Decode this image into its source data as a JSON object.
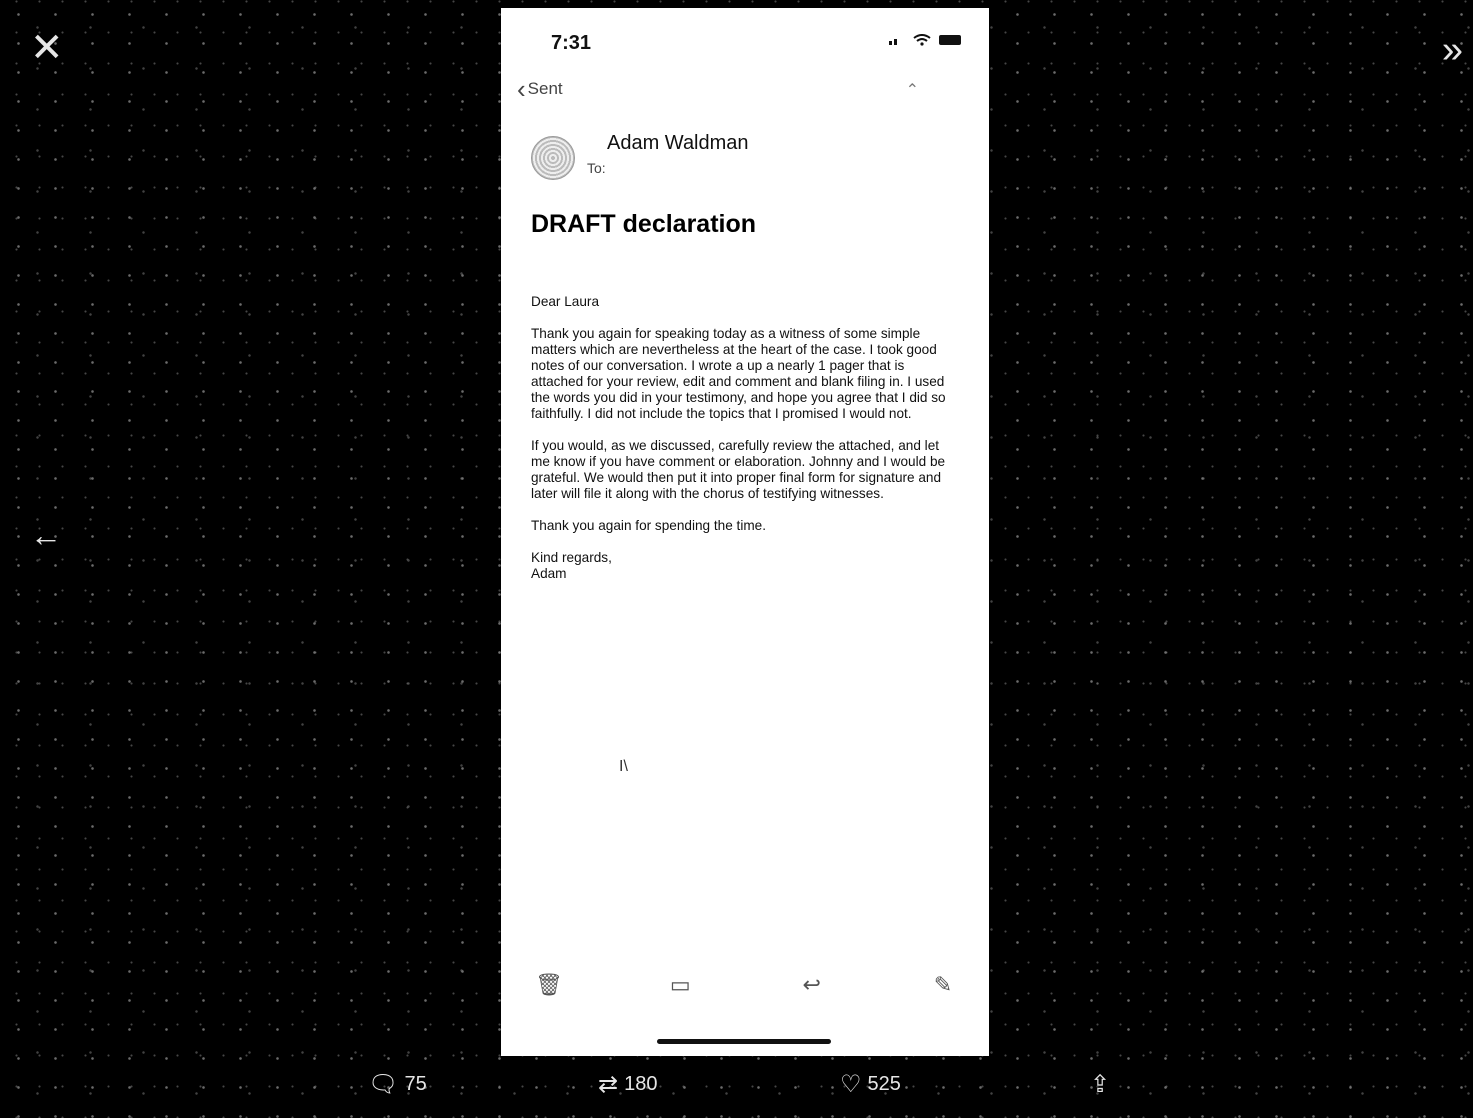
{
  "viewer": {
    "close_icon": "close-icon",
    "next_icon": "chevrons-right-icon",
    "prev_icon": "arrow-left-icon"
  },
  "phone": {
    "status": {
      "time": "7:31"
    },
    "nav": {
      "back_label": "Sent"
    },
    "sender": {
      "name": "Adam Waldman",
      "to_label": "To:"
    },
    "subject": "DRAFT declaration",
    "body": {
      "greeting": "Dear Laura",
      "p1": "Thank you again for speaking today as a witness of some simple matters which are nevertheless at the heart of the case. I took good notes of our conversation. I wrote a up a nearly 1 pager that is attached for your review, edit and comment and blank filing in. I used the words you did in your testimony, and hope you agree that I did so faithfully. I did not include the topics that I promised I would not.",
      "p2": "If you would, as we discussed, carefully review the attached, and let me know if you have comment or elaboration. Johnny and I would be grateful. We would then put it into proper final form for signature and later will file it along with the chorus of testifying witnesses.",
      "p3": "Thank you again for spending the time.",
      "closing": "Kind regards,",
      "signoff": "Adam"
    },
    "toolbar": [
      "trash-icon",
      "folder-icon",
      "reply-icon",
      "compose-icon"
    ]
  },
  "actions": {
    "replies": "75",
    "retweets": "180",
    "likes": "525"
  }
}
